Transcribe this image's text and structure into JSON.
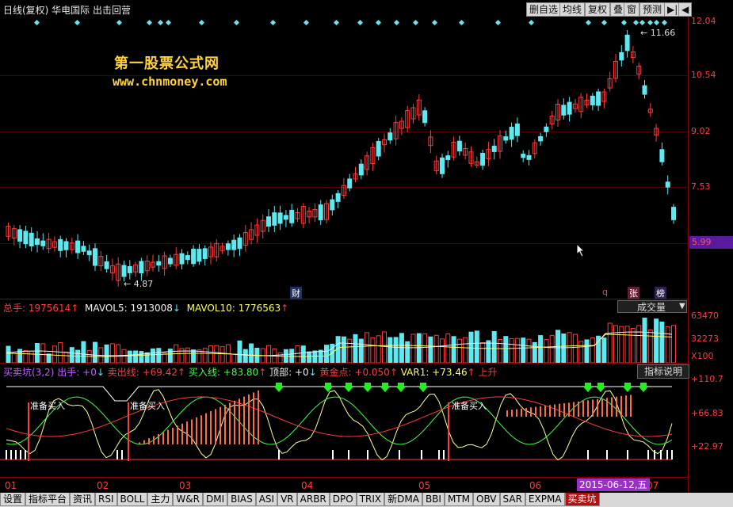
{
  "header": {
    "title": "日线(复权) 华电国际 出击回营",
    "buttons": [
      "删自选",
      "均线",
      "复权",
      "叠",
      "窗",
      "预测",
      "▶|",
      "◀"
    ]
  },
  "price_scale": {
    "ticks": [
      "12.04",
      "10.54",
      "9.02",
      "7.53",
      "5.99"
    ]
  },
  "watermark": {
    "line1": "第一股票公式网",
    "line2": "www.chnmoney.com"
  },
  "chart_annotations": {
    "high": "← 11.66",
    "low": "← 4.87",
    "cai": "财",
    "q": "q",
    "zhang": "张",
    "bang": "榜"
  },
  "volume_panel": {
    "total_label": "总手:",
    "total_value": "1975614",
    "mavol5_label": "MAVOL5:",
    "mavol5_value": "1913008",
    "mavol10_label": "MAVOL10:",
    "mavol10_value": "1776563",
    "selector": "成交量",
    "scale": [
      "63470",
      "32273",
      "X100"
    ]
  },
  "indicator_panel": {
    "name": "买卖坑(3,2)",
    "chushou": "出手: +0",
    "maichu": "卖出线: +69.42",
    "mairu": "买入线: +83.80",
    "dingbu": "顶部: +0",
    "huangjin": "黄金点: +0.050",
    "var1": "VAR1: +73.46",
    "shangsheng": "上升",
    "explain": "指标说明",
    "scale": [
      "+110.7",
      "+66.83",
      "+22.97"
    ],
    "signal": "准备买入"
  },
  "time_axis": {
    "months": [
      "01",
      "02",
      "03",
      "04",
      "05",
      "06",
      "07"
    ],
    "selected_date": "2015-06-12,五"
  },
  "tabs": [
    "设置",
    "指标平台",
    "资讯",
    "RSI",
    "BOLL",
    "主力",
    "W&R",
    "DMI",
    "BIAS",
    "ASI",
    "VR",
    "ARBR",
    "DPO",
    "TRIX",
    "新DMA",
    "BBI",
    "MTM",
    "OBV",
    "SAR",
    "EXPMA",
    "买卖坑"
  ],
  "colors": {
    "up": "#ff3b3b",
    "down": "#5ee8f0",
    "grid": "#8a0000",
    "ma5": "#f0f0f0",
    "ma10": "#ffff66"
  }
}
